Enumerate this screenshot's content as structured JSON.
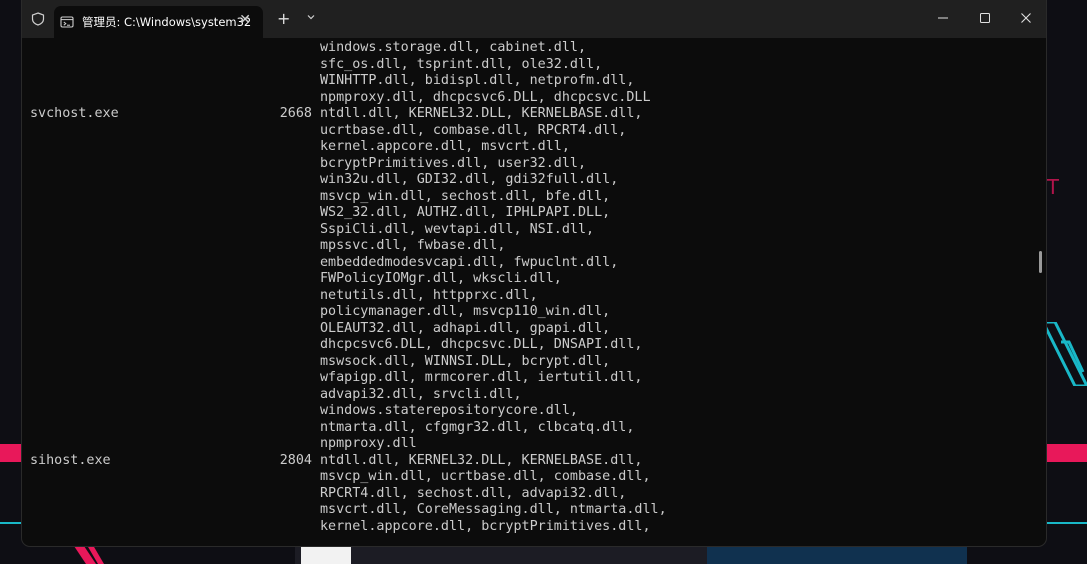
{
  "window": {
    "tab_title": "管理员: C:\\Windows\\system32",
    "new_tab_label": "+",
    "tab_close_label": "✕"
  },
  "output": {
    "rows": [
      {
        "name": "",
        "pid": "",
        "modules": "windows.storage.dll, cabinet.dll,"
      },
      {
        "name": "",
        "pid": "",
        "modules": "sfc_os.dll, tsprint.dll, ole32.dll,"
      },
      {
        "name": "",
        "pid": "",
        "modules": "WINHTTP.dll, bidispl.dll, netprofm.dll,"
      },
      {
        "name": "",
        "pid": "",
        "modules": "npmproxy.dll, dhcpcsvc6.DLL, dhcpcsvc.DLL"
      },
      {
        "name": "svchost.exe",
        "pid": "2668",
        "modules": "ntdll.dll, KERNEL32.DLL, KERNELBASE.dll,"
      },
      {
        "name": "",
        "pid": "",
        "modules": "ucrtbase.dll, combase.dll, RPCRT4.dll,"
      },
      {
        "name": "",
        "pid": "",
        "modules": "kernel.appcore.dll, msvcrt.dll,"
      },
      {
        "name": "",
        "pid": "",
        "modules": "bcryptPrimitives.dll, user32.dll,"
      },
      {
        "name": "",
        "pid": "",
        "modules": "win32u.dll, GDI32.dll, gdi32full.dll,"
      },
      {
        "name": "",
        "pid": "",
        "modules": "msvcp_win.dll, sechost.dll, bfe.dll,"
      },
      {
        "name": "",
        "pid": "",
        "modules": "WS2_32.dll, AUTHZ.dll, IPHLPAPI.DLL,"
      },
      {
        "name": "",
        "pid": "",
        "modules": "SspiCli.dll, wevtapi.dll, NSI.dll,"
      },
      {
        "name": "",
        "pid": "",
        "modules": "mpssvc.dll, fwbase.dll,"
      },
      {
        "name": "",
        "pid": "",
        "modules": "embeddedmodesvcapi.dll, fwpuclnt.dll,"
      },
      {
        "name": "",
        "pid": "",
        "modules": "FWPolicyIOMgr.dll, wkscli.dll,"
      },
      {
        "name": "",
        "pid": "",
        "modules": "netutils.dll, httpprxc.dll,"
      },
      {
        "name": "",
        "pid": "",
        "modules": "policymanager.dll, msvcp110_win.dll,"
      },
      {
        "name": "",
        "pid": "",
        "modules": "OLEAUT32.dll, adhapi.dll, gpapi.dll,"
      },
      {
        "name": "",
        "pid": "",
        "modules": "dhcpcsvc6.DLL, dhcpcsvc.DLL, DNSAPI.dll,"
      },
      {
        "name": "",
        "pid": "",
        "modules": "mswsock.dll, WINNSI.DLL, bcrypt.dll,"
      },
      {
        "name": "",
        "pid": "",
        "modules": "wfapigp.dll, mrmcorer.dll, iertutil.dll,"
      },
      {
        "name": "",
        "pid": "",
        "modules": "advapi32.dll, srvcli.dll,"
      },
      {
        "name": "",
        "pid": "",
        "modules": "windows.staterepositorycore.dll,"
      },
      {
        "name": "",
        "pid": "",
        "modules": "ntmarta.dll, cfgmgr32.dll, clbcatq.dll,"
      },
      {
        "name": "",
        "pid": "",
        "modules": "npmproxy.dll"
      },
      {
        "name": "sihost.exe",
        "pid": "2804",
        "modules": "ntdll.dll, KERNEL32.DLL, KERNELBASE.dll,"
      },
      {
        "name": "",
        "pid": "",
        "modules": "msvcp_win.dll, ucrtbase.dll, combase.dll,"
      },
      {
        "name": "",
        "pid": "",
        "modules": "RPCRT4.dll, sechost.dll, advapi32.dll,"
      },
      {
        "name": "",
        "pid": "",
        "modules": "msvcrt.dll, CoreMessaging.dll, ntmarta.dll,"
      },
      {
        "name": "",
        "pid": "",
        "modules": "kernel.appcore.dll, bcryptPrimitives.dll,"
      }
    ]
  },
  "colors": {
    "terminal_bg": "#0c0c0c",
    "titlebar_bg": "#202020",
    "text": "#cccccc"
  },
  "background": {
    "accent_letter": "T"
  },
  "icons": {
    "shield": "shield-icon",
    "tab": "terminal-icon",
    "dropdown": "chevron-down-icon",
    "minimize": "minimize-icon",
    "maximize": "maximize-icon",
    "close": "close-icon"
  }
}
